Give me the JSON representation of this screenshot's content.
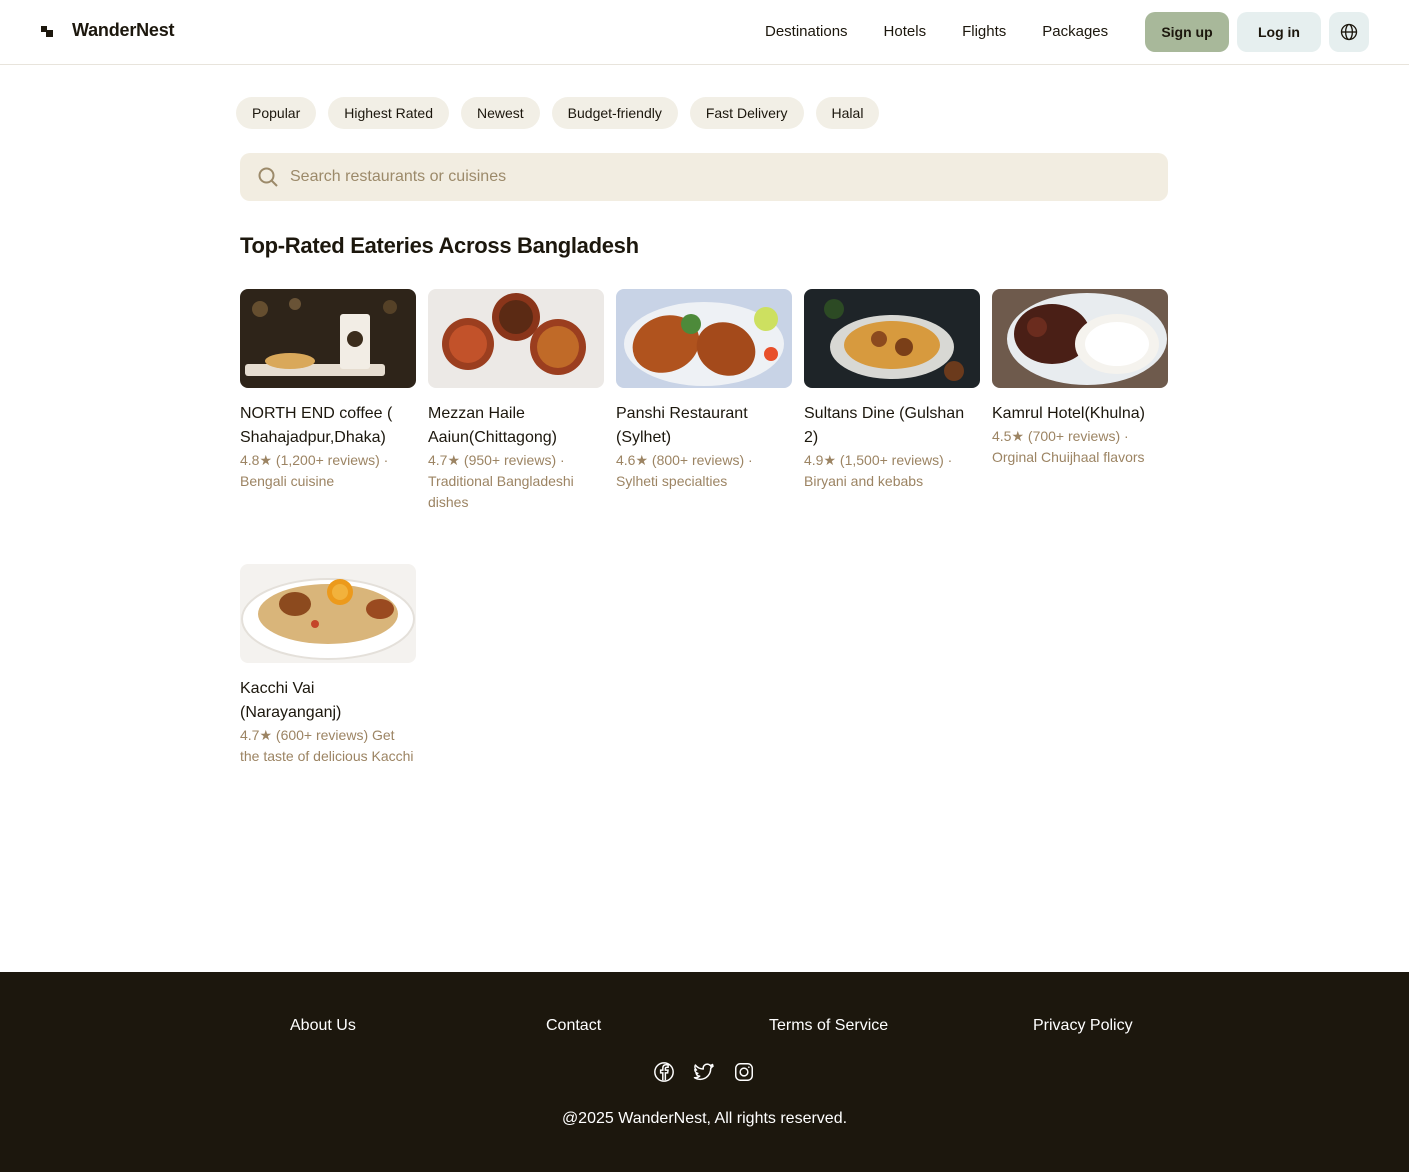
{
  "header": {
    "brand": "WanderNest",
    "nav": [
      "Destinations",
      "Hotels",
      "Flights",
      "Packages"
    ],
    "signup_label": "Sign up",
    "login_label": "Log in",
    "globe_icon": "globe-icon"
  },
  "filters": [
    "Popular",
    "Highest Rated",
    "Newest",
    "Budget-friendly",
    "Fast Delivery",
    "Halal"
  ],
  "search": {
    "placeholder": "Search restaurants or cuisines",
    "value": ""
  },
  "section_title": "Top-Rated Eateries Across Bangladesh",
  "eateries": [
    {
      "name": "NORTH END coffee ( Shahajadpur,Dhaka)",
      "meta": "4.8★ (1,200+ reviews) · Bengali cuisine"
    },
    {
      "name": "Mezzan Haile Aaiun(Chittagong)",
      "meta": "4.7★ (950+ reviews) · Traditional Bangladeshi dishes"
    },
    {
      "name": "Panshi Restaurant (Sylhet)",
      "meta": "4.6★ (800+ reviews) · Sylheti specialties"
    },
    {
      "name": "Sultans Dine (Gulshan 2)",
      "meta": "4.9★ (1,500+ reviews) · Biryani and kebabs"
    },
    {
      "name": "Kamrul Hotel(Khulna)",
      "meta": "4.5★ (700+ reviews) · Orginal Chuijhaal flavors"
    },
    {
      "name": "Kacchi Vai (Narayanganj)",
      "meta": "4.7★ (600+ reviews) Get the taste of delicious Kacchi"
    }
  ],
  "footer": {
    "links": [
      "About Us",
      "Contact",
      "Terms of Service",
      "Privacy Policy"
    ],
    "social_icons": [
      "facebook-icon",
      "twitter-icon",
      "instagram-icon"
    ],
    "copyright": "@2025 WanderNest, All rights reserved."
  }
}
